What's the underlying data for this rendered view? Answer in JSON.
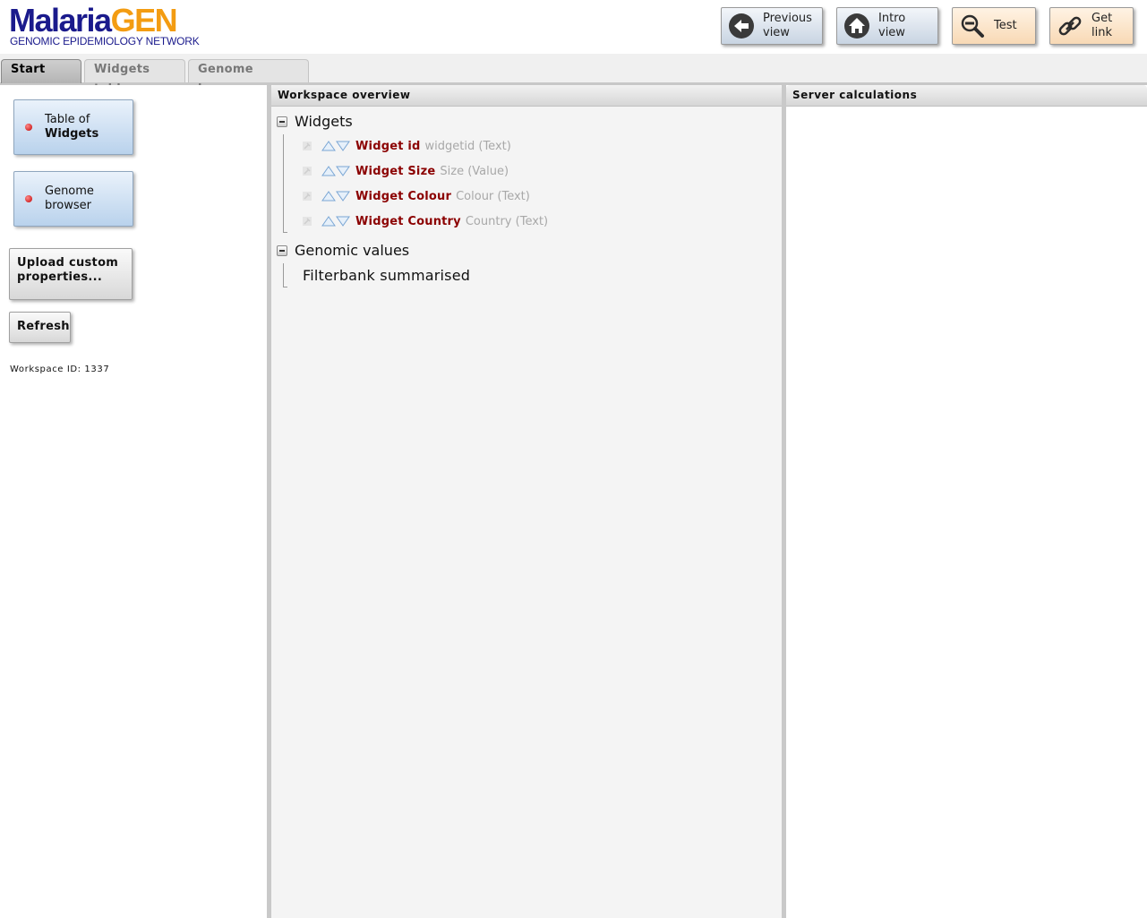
{
  "header": {
    "logo": {
      "main_a": "Malaria",
      "main_b": "GEN",
      "subtitle": "GENOMIC EPIDEMIOLOGY NETWORK"
    },
    "buttons": [
      {
        "label": "Previous view",
        "icon": "arrow-left-circle-icon"
      },
      {
        "label": "Intro view",
        "icon": "home-icon"
      },
      {
        "label": "Test",
        "icon": "magnifier-icon"
      },
      {
        "label": "Get link",
        "icon": "link-icon"
      }
    ]
  },
  "tabs": [
    {
      "label": "Start page",
      "active": true
    },
    {
      "label": "Widgets table",
      "active": false
    },
    {
      "label": "Genome browser",
      "active": false
    }
  ],
  "sidebar": {
    "nav": [
      {
        "line1": "Table of",
        "line2": "Widgets"
      },
      {
        "line1": "Genome",
        "line2": "browser"
      }
    ],
    "upload_label": "Upload custom properties...",
    "refresh_label": "Refresh",
    "workspace_id": "Workspace ID: 1337"
  },
  "workspace": {
    "title": "Workspace overview",
    "groups": [
      {
        "name": "Widgets",
        "properties": [
          {
            "name": "Widget id",
            "desc": "widgetid (Text)"
          },
          {
            "name": "Widget Size",
            "desc": "Size (Value)"
          },
          {
            "name": "Widget Colour",
            "desc": "Colour (Text)"
          },
          {
            "name": "Widget Country",
            "desc": "Country (Text)"
          }
        ]
      },
      {
        "name": "Genomic values",
        "items": [
          "Filterbank summarised"
        ]
      }
    ]
  },
  "server": {
    "title": "Server calculations"
  },
  "colors": {
    "accent_blue": "#1a1a8c",
    "accent_orange": "#f39c12",
    "property_name": "#8b0000"
  }
}
